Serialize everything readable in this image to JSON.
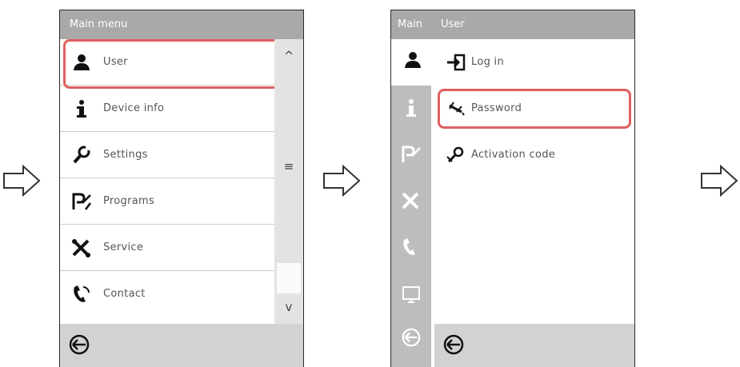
{
  "screen1": {
    "title": "Main menu",
    "items": [
      {
        "label": "User",
        "icon": "user-icon"
      },
      {
        "label": "Device info",
        "icon": "info-icon"
      },
      {
        "label": "Settings",
        "icon": "settings-icon"
      },
      {
        "label": "Programs",
        "icon": "programs-icon"
      },
      {
        "label": "Service",
        "icon": "service-icon"
      },
      {
        "label": "Contact",
        "icon": "contact-icon"
      }
    ],
    "scroll_up": "^",
    "scroll_mid": "≡",
    "scroll_down": "v"
  },
  "screen2": {
    "title_left": "Main",
    "title_right": "User",
    "items": [
      {
        "label": "Log in",
        "icon": "login-icon"
      },
      {
        "label": "Password",
        "icon": "password-icon"
      },
      {
        "label": "Activation code",
        "icon": "activation-code-icon"
      }
    ]
  },
  "colors": {
    "highlight": "#e06060",
    "header": "#a9a9a9",
    "footer": "#d2d2d2"
  }
}
